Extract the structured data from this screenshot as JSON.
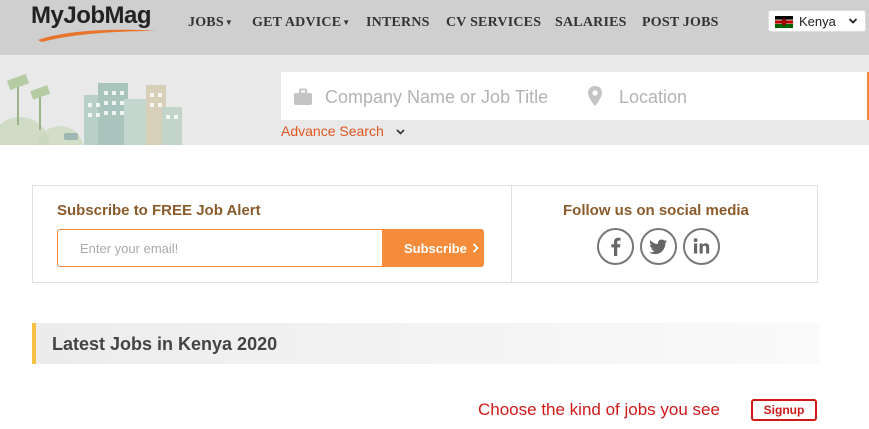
{
  "header": {
    "logo_text": "MyJobMag",
    "nav": [
      {
        "label": "JOBS",
        "has_caret": true
      },
      {
        "label": "GET ADVICE",
        "has_caret": true
      },
      {
        "label": "INTERNS",
        "has_caret": false
      },
      {
        "label": "CV SERVICES",
        "has_caret": false
      },
      {
        "label": "SALARIES",
        "has_caret": false
      },
      {
        "label": "POST JOBS",
        "has_caret": false
      }
    ],
    "country": {
      "label": "Kenya",
      "icon": "kenya-flag-icon"
    }
  },
  "search": {
    "job_placeholder": "Company Name or Job Title",
    "location_placeholder": "Location",
    "advance_link": "Advance Search",
    "job_icon": "briefcase-icon",
    "location_icon": "map-pin-icon"
  },
  "subscribe": {
    "title": "Subscribe to FREE Job Alert",
    "email_placeholder": "Enter your email!",
    "button_label": "Subscribe"
  },
  "social": {
    "title": "Follow us on social media",
    "networks": [
      {
        "name": "facebook",
        "icon": "facebook-icon"
      },
      {
        "name": "twitter",
        "icon": "twitter-icon"
      },
      {
        "name": "linkedin",
        "icon": "linkedin-icon"
      }
    ]
  },
  "latest": {
    "title": "Latest Jobs in Kenya 2020"
  },
  "signup_prompt": {
    "text": "Choose the kind of jobs you see",
    "button_label": "Signup"
  },
  "colors": {
    "accent_orange": "#f58c3b",
    "link_orange": "#e0561f",
    "heading_brown": "#8b5b2b",
    "signup_red": "#d01a1a",
    "highlight_yellow": "#f5c044"
  }
}
